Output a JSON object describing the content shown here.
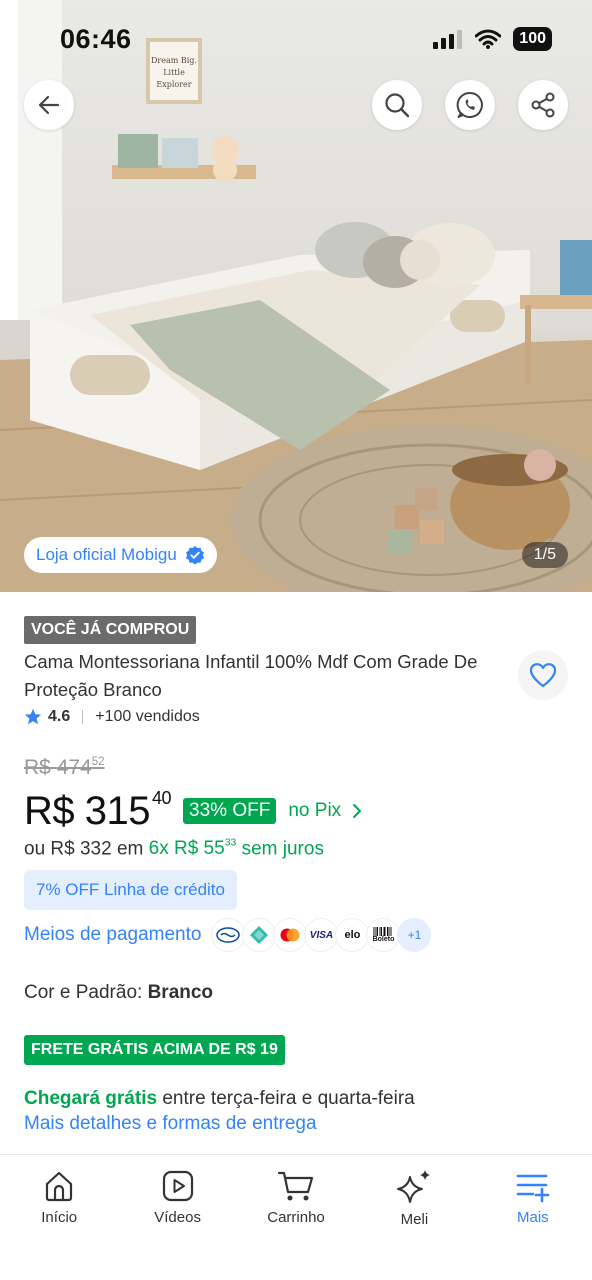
{
  "status_bar": {
    "time": "06:46",
    "battery": "100"
  },
  "hero": {
    "poster_text": "Dream Big. Little Explorer",
    "official_store": "Loja oficial Mobigu",
    "counter": "1/5"
  },
  "product": {
    "bought_badge": "VOCÊ JÁ COMPROU",
    "title": "Cama Montessoriana Infantil 100% Mdf Com Grade De Proteção Branco",
    "rating": "4.6",
    "sold": "+100 vendidos",
    "old_price": {
      "currency": "R$",
      "integer": "474",
      "cents": "52"
    },
    "price": {
      "currency": "R$",
      "integer": "315",
      "cents": "40"
    },
    "discount": "33% OFF",
    "pix_label": "no Pix",
    "installments": {
      "prefix": "ou R$ 332 em",
      "count": "6x R$ 55",
      "cents": "33",
      "suffix": "sem juros"
    },
    "credit_chip": "7% OFF Linha de crédito",
    "payments_label": "Meios de pagamento",
    "payment_methods": [
      "mercado-pago-icon",
      "pix-icon",
      "mastercard-icon",
      "VISA",
      "elo",
      "Boleto"
    ],
    "payment_more": "+1",
    "variant_label": "Cor e Padrão:",
    "variant_value": "Branco",
    "shipping_badge": "FRETE GRÁTIS ACIMA DE R$ 19",
    "delivery_highlight": "Chegará grátis",
    "delivery_text": "entre terça-feira e quarta-feira",
    "delivery_link": "Mais detalhes e formas de entrega"
  },
  "bottom_nav": {
    "items": [
      {
        "label": "Início",
        "icon": "home-icon"
      },
      {
        "label": "Vídeos",
        "icon": "play-icon"
      },
      {
        "label": "Carrinho",
        "icon": "cart-icon"
      },
      {
        "label": "Meli",
        "icon": "sparkle-icon"
      },
      {
        "label": "Mais",
        "icon": "menu-plus-icon",
        "active": true
      }
    ]
  },
  "colors": {
    "brand_blue": "#3483fa",
    "green": "#00a650",
    "badge_gray": "#6b6b6b"
  }
}
